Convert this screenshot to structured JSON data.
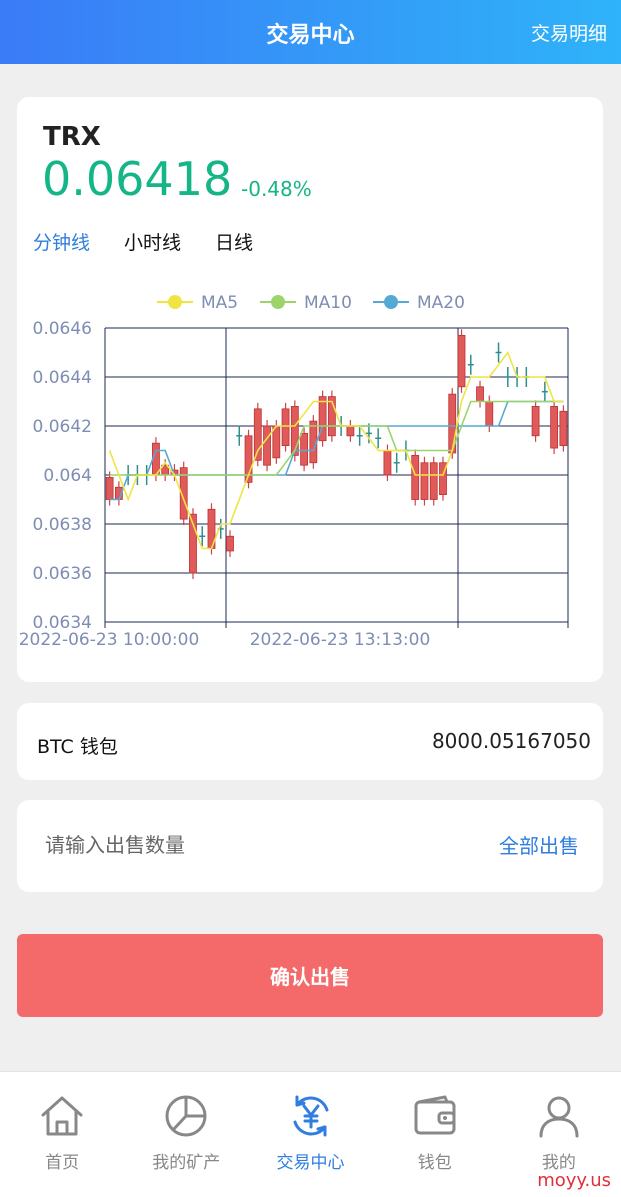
{
  "header": {
    "title": "交易中心",
    "right_link": "交易明细"
  },
  "ticker": {
    "symbol": "TRX",
    "price": "0.06418",
    "change": "-0.48%"
  },
  "tabs": [
    {
      "label": "分钟线",
      "active": true
    },
    {
      "label": "小时线",
      "active": false
    },
    {
      "label": "日线",
      "active": false
    }
  ],
  "chart_data": {
    "type": "candlestick",
    "legend": [
      "MA5",
      "MA10",
      "MA20"
    ],
    "legend_position": "top-center",
    "colors": {
      "MA5": "#f0e442",
      "MA10": "#9cd36b",
      "MA20": "#55a9d4",
      "candle": "#e05a5a",
      "up_wick": "#2f8f8f"
    },
    "ylim": [
      0.0634,
      0.0646
    ],
    "yticks": [
      "0.0646",
      "0.0644",
      "0.0642",
      "0.064",
      "0.0638",
      "0.0636",
      "0.0634"
    ],
    "xticks": [
      "2022-06-23 10:00:00",
      "2022-06-23 13:13:00"
    ],
    "grid": true,
    "candles": [
      [
        0.06399,
        0.0639
      ],
      [
        0.06395,
        0.0639
      ],
      [
        0.064,
        0.064
      ],
      [
        0.064,
        0.064
      ],
      [
        0.064,
        0.064
      ],
      [
        0.06413,
        0.064
      ],
      [
        0.06404,
        0.064
      ],
      [
        0.06402,
        0.064
      ],
      [
        0.06403,
        0.06382
      ],
      [
        0.06384,
        0.0636
      ],
      [
        0.06375,
        0.06375
      ],
      [
        0.06386,
        0.0637
      ],
      [
        0.06378,
        0.06378
      ],
      [
        0.06375,
        0.06369
      ],
      [
        0.06416,
        0.06416
      ],
      [
        0.06416,
        0.06397
      ],
      [
        0.06427,
        0.06406
      ],
      [
        0.0642,
        0.06404
      ],
      [
        0.0642,
        0.06407
      ],
      [
        0.06427,
        0.06412
      ],
      [
        0.06428,
        0.06408
      ],
      [
        0.06417,
        0.06404
      ],
      [
        0.06422,
        0.06405
      ],
      [
        0.06432,
        0.06414
      ],
      [
        0.06432,
        0.06416
      ],
      [
        0.0642,
        0.0642
      ],
      [
        0.0642,
        0.06416
      ],
      [
        0.06416,
        0.06416
      ],
      [
        0.06417,
        0.06417
      ],
      [
        0.06415,
        0.06415
      ],
      [
        0.0641,
        0.064
      ],
      [
        0.06405,
        0.06405
      ],
      [
        0.0641,
        0.0641
      ],
      [
        0.06408,
        0.0639
      ],
      [
        0.06405,
        0.0639
      ],
      [
        0.06405,
        0.0639
      ],
      [
        0.06405,
        0.06392
      ],
      [
        0.06433,
        0.06409
      ],
      [
        0.06457,
        0.06436
      ],
      [
        0.06445,
        0.06445
      ],
      [
        0.06436,
        0.0643
      ],
      [
        0.0643,
        0.0642
      ],
      [
        0.0645,
        0.0645
      ],
      [
        0.0644,
        0.0644
      ],
      [
        0.0644,
        0.0644
      ],
      [
        0.0644,
        0.0644
      ],
      [
        0.06428,
        0.06416
      ],
      [
        0.06434,
        0.06434
      ],
      [
        0.06428,
        0.06411
      ],
      [
        0.06426,
        0.06412
      ]
    ],
    "ma5": [
      0.0641,
      0.064,
      0.0639,
      0.064,
      0.064,
      0.064,
      0.06405,
      0.064,
      0.0639,
      0.0638,
      0.0637,
      0.0637,
      0.0638,
      0.0638,
      0.0639,
      0.064,
      0.0641,
      0.06415,
      0.0642,
      0.0642,
      0.0642,
      0.06425,
      0.0643,
      0.0643,
      0.0643,
      0.0642,
      0.0642,
      0.0642,
      0.06415,
      0.0641,
      0.0641,
      0.0641,
      0.0641,
      0.064,
      0.064,
      0.064,
      0.064,
      0.0641,
      0.0643,
      0.0644,
      0.0644,
      0.0644,
      0.06445,
      0.0645,
      0.0644,
      0.0644,
      0.0644,
      0.0644,
      0.0643,
      0.0643
    ],
    "ma10": [
      0.064,
      0.064,
      0.064,
      0.064,
      0.064,
      0.064,
      0.064,
      0.064,
      0.064,
      0.064,
      0.064,
      0.064,
      0.064,
      0.064,
      0.064,
      0.064,
      0.064,
      0.064,
      0.064,
      0.06405,
      0.0641,
      0.0642,
      0.0642,
      0.0642,
      0.0642,
      0.0642,
      0.0642,
      0.0642,
      0.0642,
      0.0642,
      0.0642,
      0.0641,
      0.0641,
      0.0641,
      0.0641,
      0.0641,
      0.0641,
      0.0641,
      0.0642,
      0.0643,
      0.0643,
      0.0643,
      0.0643,
      0.0643,
      0.0643,
      0.0643,
      0.0643,
      0.0643,
      0.0643,
      0.0643
    ],
    "ma20": [
      0.0639,
      0.0639,
      0.064,
      0.064,
      0.064,
      0.0641,
      0.0641,
      0.064,
      0.064,
      0.064,
      0.064,
      0.064,
      0.064,
      0.064,
      0.064,
      0.064,
      0.064,
      0.064,
      0.064,
      0.064,
      0.0641,
      0.0641,
      0.0641,
      0.0642,
      0.0642,
      0.0642,
      0.0642,
      0.0642,
      0.0642,
      0.0642,
      0.0642,
      0.0642,
      0.0642,
      0.0642,
      0.0642,
      0.0642,
      0.0642,
      0.0642,
      0.0642,
      0.0642,
      0.0642,
      0.0642,
      0.0642,
      0.0643,
      0.0643,
      0.0643,
      0.0643,
      0.0643,
      0.0643,
      0.0643
    ]
  },
  "wallet": {
    "name": "BTC 钱包",
    "balance": "8000.05167050"
  },
  "quantity": {
    "placeholder": "请输入出售数量",
    "sell_all": "全部出售"
  },
  "confirm": {
    "label": "确认出售"
  },
  "nav": [
    {
      "label": "首页",
      "icon": "home-icon",
      "active": false
    },
    {
      "label": "我的矿产",
      "icon": "pie-chart-icon",
      "active": false
    },
    {
      "label": "交易中心",
      "icon": "yuan-exchange-icon",
      "active": true
    },
    {
      "label": "钱包",
      "icon": "wallet-icon",
      "active": false
    },
    {
      "label": "我的",
      "icon": "user-icon",
      "active": false
    }
  ],
  "watermark": "moyy.us"
}
